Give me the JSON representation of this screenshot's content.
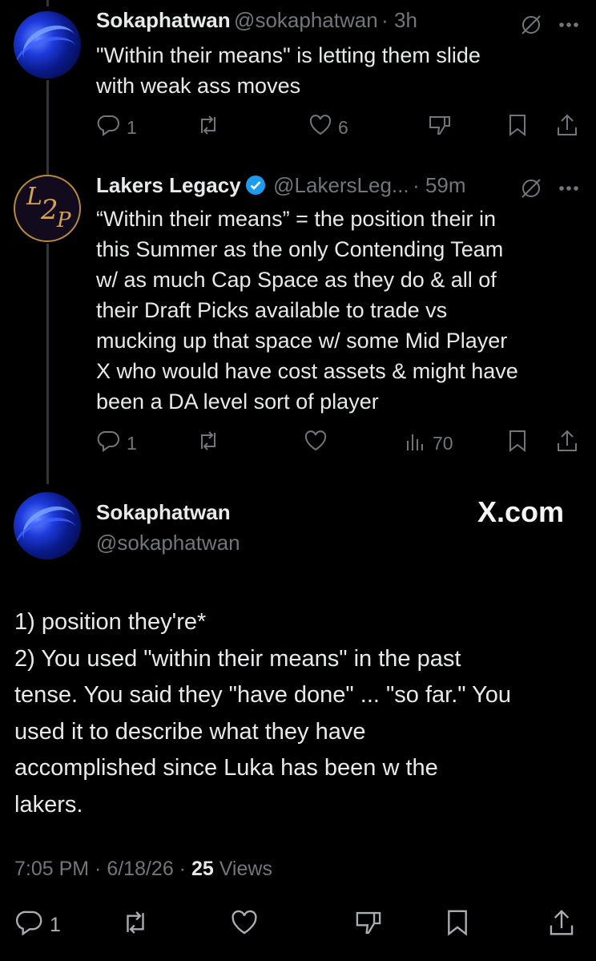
{
  "tweet1": {
    "name": "Sokaphatwan",
    "handle": "@sokaphatwan",
    "time": "· 3h",
    "text": "\"Within their means\" is letting them slide\nwith weak ass moves",
    "replies": "1",
    "likes": "6"
  },
  "tweet2": {
    "name": "Lakers Legacy",
    "handle": "@LakersLeg...",
    "time": "· 59m",
    "text": "“Within their means” = the position their in\nthis Summer as the only Contending Team\nw/ as much Cap Space as they do & all of\ntheir Draft Picks available to trade vs\nmucking up that space w/ some Mid Player\nX who would have cost assets & might have\nbeen a DA level sort of player",
    "replies": "1",
    "views": "70",
    "avatar_letters": [
      "L",
      "2",
      "P"
    ]
  },
  "main": {
    "name": "Sokaphatwan",
    "handle": "@sokaphatwan",
    "watermark": "X.com",
    "text": "1) position they're*\n2) You used \"within their means\" in the past\ntense. You said they \"have done\" ... \"so far.\" You\nused it to describe what they have\naccomplished since Luka has been w the\nlakers.",
    "timestamp": "7:05 PM · 6/18/26 · ",
    "views_count": "25",
    "views_label": " Views",
    "replies": "1"
  },
  "icons": [
    "reply-icon",
    "repost-icon",
    "like-icon",
    "dislike-icon",
    "bookmark-icon",
    "share-icon",
    "views-icon",
    "grok-icon",
    "more-icon",
    "verified-icon"
  ],
  "colors": {
    "background": "#000000",
    "text": "#e7e9ea",
    "muted": "#71767b",
    "verified": "#1d9bf0",
    "thread_line": "#333639"
  }
}
